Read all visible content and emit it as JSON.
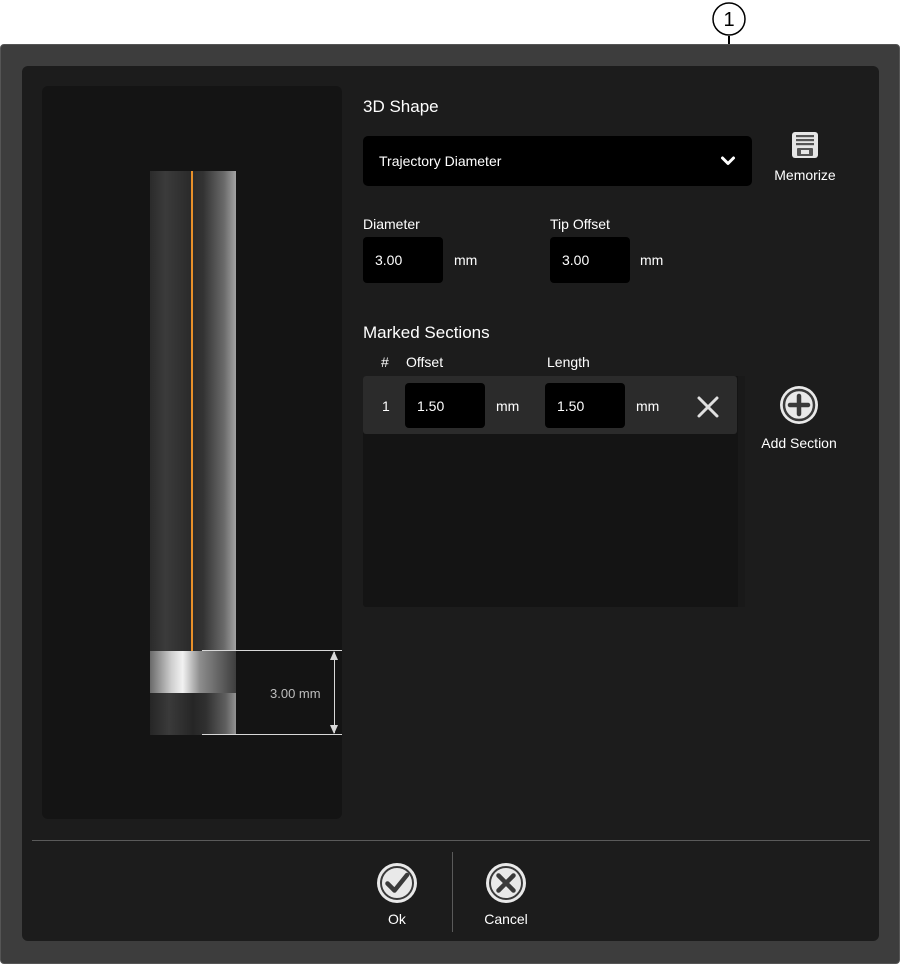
{
  "callout": {
    "number": "1"
  },
  "preview": {
    "dimension_label": "3.00 mm",
    "accent_color": "#e8902a"
  },
  "shape": {
    "heading": "3D Shape",
    "dropdown_value": "Trajectory Diameter",
    "memorize_label": "Memorize"
  },
  "diameter": {
    "label": "Diameter",
    "value": "3.00",
    "unit": "mm"
  },
  "tip_offset": {
    "label": "Tip Offset",
    "value": "3.00",
    "unit": "mm"
  },
  "marked_sections": {
    "heading": "Marked Sections",
    "columns": {
      "num": "#",
      "offset": "Offset",
      "length": "Length"
    },
    "rows": [
      {
        "num": "1",
        "offset": "1.50",
        "offset_unit": "mm",
        "length": "1.50",
        "length_unit": "mm"
      }
    ],
    "add_label": "Add Section"
  },
  "footer": {
    "ok_label": "Ok",
    "cancel_label": "Cancel"
  },
  "icons": {
    "dropdown": "chevron-down-icon",
    "memorize": "floppy-disk-icon",
    "remove": "close-icon",
    "add": "plus-circle-icon",
    "ok": "check-circle-icon",
    "cancel": "x-circle-icon"
  }
}
